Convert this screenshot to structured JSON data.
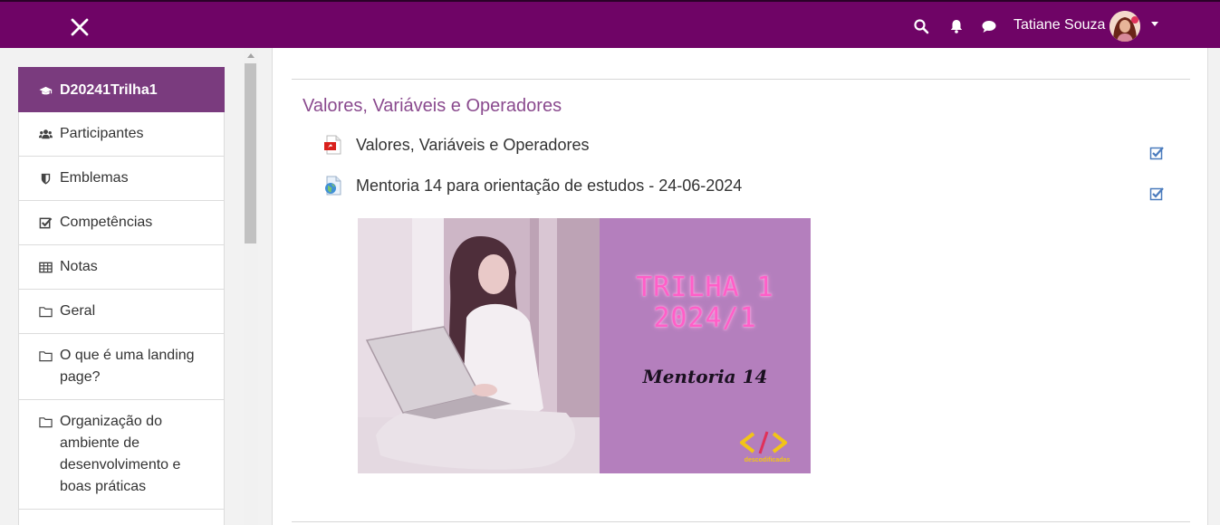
{
  "header": {
    "user_name": "Tatiane Souza",
    "icons": [
      "close-icon",
      "search-icon",
      "bell-icon",
      "chat-icon",
      "caret-down-icon"
    ]
  },
  "sidebar": {
    "items": [
      {
        "label": "D20241Trilha1",
        "icon": "graduation-cap-icon",
        "active": true
      },
      {
        "label": "Participantes",
        "icon": "users-icon"
      },
      {
        "label": "Emblemas",
        "icon": "shield-icon"
      },
      {
        "label": "Competências",
        "icon": "check-square-icon"
      },
      {
        "label": "Notas",
        "icon": "table-icon"
      },
      {
        "label": "Geral",
        "icon": "folder-icon"
      },
      {
        "label": "O que é uma landing page?",
        "icon": "folder-icon"
      },
      {
        "label": "Organização do ambiente de desenvolvimento e boas práticas",
        "icon": "folder-icon"
      }
    ]
  },
  "main": {
    "section_title": "Valores, Variáveis e Operadores",
    "activities": [
      {
        "label": "Valores, Variáveis e Operadores",
        "icon": "pdf-file-icon",
        "completed": true
      },
      {
        "label": "Mentoria 14 para orientação de estudos - 24-06-2024",
        "icon": "url-link-icon",
        "completed": true
      }
    ],
    "banner": {
      "title_line1": "TRILHA 1",
      "title_line2": "2024/1",
      "subtitle": "Mentoria 14",
      "logo_text": "descodificadas"
    }
  },
  "colors": {
    "navbar": "#6f0466",
    "sidebar_active": "#7a3b7e",
    "section_title": "#8a4a8e",
    "check": "#4a7bbd"
  }
}
